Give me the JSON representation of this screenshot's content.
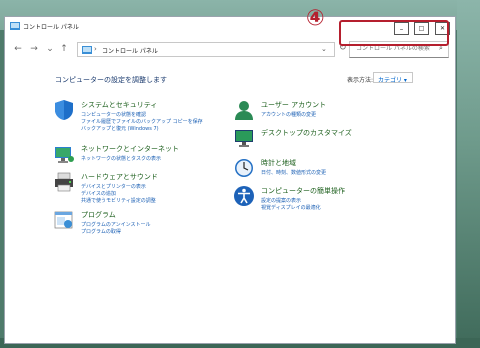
{
  "window": {
    "title": "コントロール パネル",
    "controls": {
      "minimize": "–",
      "maximize": "□",
      "close": "✕"
    }
  },
  "annotation": {
    "step_marker": "④",
    "color": "#b51f2e"
  },
  "nav": {
    "back": "←",
    "forward": "→",
    "recent": "⌄",
    "up": "↑",
    "crumb_sep": "›",
    "address": "コントロール パネル",
    "address_chevron": "⌄",
    "refresh": "↻"
  },
  "search": {
    "placeholder": "コントロール パネルの検索"
  },
  "main": {
    "heading": "コンピューターの設定を調整します",
    "view_by_label": "表示方法:",
    "view_by_value": "カテゴリ ▾"
  },
  "categories_left": [
    {
      "title": "システムとセキュリティ",
      "icon": "shield-icon",
      "links": [
        "コンピューターの状態を確認",
        "ファイル履歴でファイルのバックアップ コピーを保存",
        "バックアップと復元 (Windows 7)"
      ]
    },
    {
      "title": "ネットワークとインターネット",
      "icon": "network-icon",
      "links": [
        "ネットワークの状態とタスクの表示"
      ]
    },
    {
      "title": "ハードウェアとサウンド",
      "icon": "printer-icon",
      "links": [
        "デバイスとプリンターの表示",
        "デバイスの追加",
        "共通で使うモビリティ設定の調整"
      ]
    },
    {
      "title": "プログラム",
      "icon": "programs-icon",
      "links": [
        "プログラムのアンインストール",
        "プログラムの取得"
      ]
    }
  ],
  "categories_right": [
    {
      "title": "ユーザー アカウント",
      "icon": "user-icon",
      "links": [
        "アカウントの種類の変更"
      ]
    },
    {
      "title": "デスクトップのカスタマイズ",
      "icon": "desktop-icon",
      "links": []
    },
    {
      "title": "時計と地域",
      "icon": "clock-icon",
      "links": [
        "日付、時刻、数値形式の変更"
      ]
    },
    {
      "title": "コンピューターの簡単操作",
      "icon": "accessibility-icon",
      "links": [
        "設定の提案の表示",
        "視覚ディスプレイの最適化"
      ]
    }
  ],
  "colors": {
    "title_green": "#1b5e1b",
    "link_blue": "#1a5fb4",
    "heading_blue": "#1a3a6e"
  }
}
